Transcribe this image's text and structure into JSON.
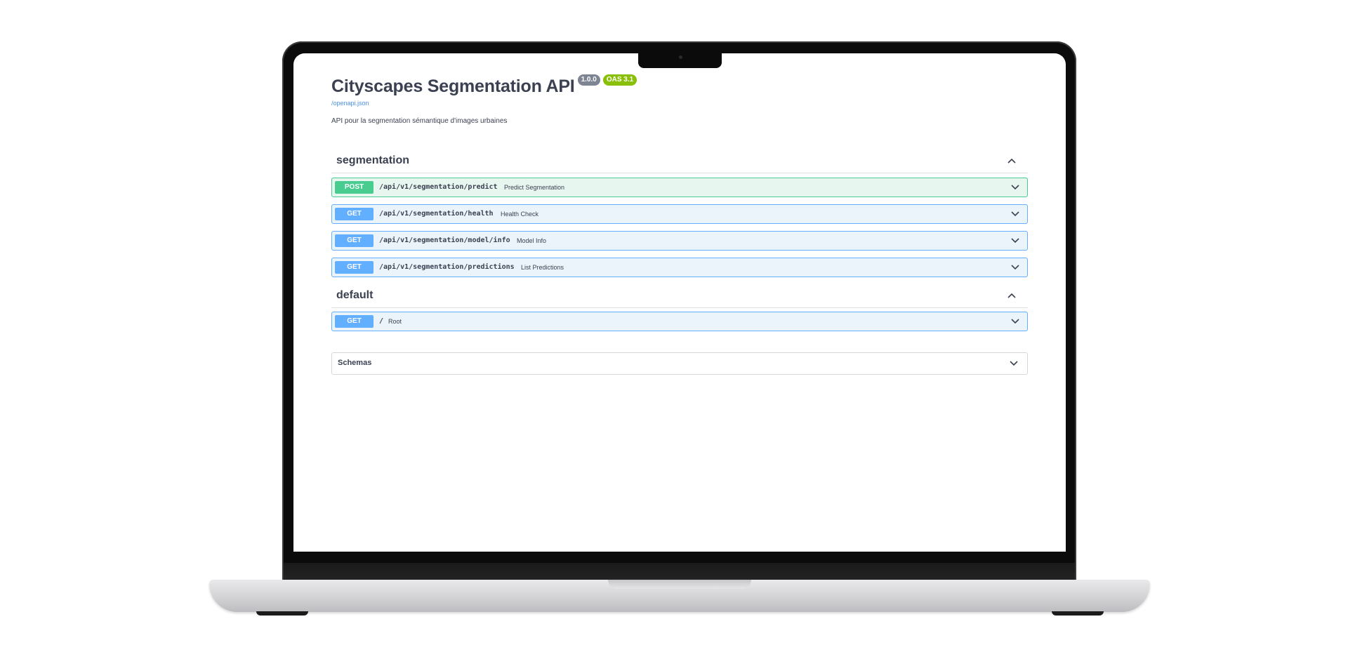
{
  "api": {
    "title": "Cityscapes Segmentation API",
    "version_badge": "1.0.0",
    "oas_badge": "OAS 3.1",
    "spec_link": "/openapi.json",
    "description": "API pour la segmentation sémantique d'images urbaines"
  },
  "sections": {
    "segmentation": {
      "name": "segmentation",
      "operations": [
        {
          "method": "POST",
          "path": "/api/v1/segmentation/predict",
          "summary": "Predict Segmentation"
        },
        {
          "method": "GET",
          "path": "/api/v1/segmentation/health",
          "summary": "Health Check"
        },
        {
          "method": "GET",
          "path": "/api/v1/segmentation/model/info",
          "summary": "Model Info"
        },
        {
          "method": "GET",
          "path": "/api/v1/segmentation/predictions",
          "summary": "List Predictions"
        }
      ]
    },
    "default": {
      "name": "default",
      "operations": [
        {
          "method": "GET",
          "path": "/",
          "summary": "Root"
        }
      ]
    }
  },
  "schemas": {
    "label": "Schemas"
  },
  "icons": {
    "section_toggle": "chevron-up-icon",
    "operation_toggle": "chevron-down-icon"
  },
  "colors": {
    "post": "#49cc90",
    "get": "#61affe",
    "version_badge": "#7d8492",
    "oas_badge": "#89bf04"
  }
}
